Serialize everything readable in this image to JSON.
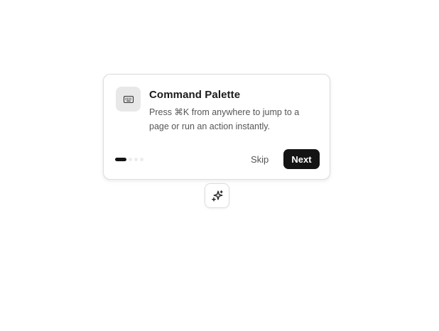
{
  "tour": {
    "icon": "keyboard-icon",
    "title": "Command Palette",
    "description": "Press ⌘K from anywhere to jump to a page or run an action instantly.",
    "progress": {
      "current_step": 1,
      "total_steps": 4
    },
    "skip_label": "Skip",
    "next_label": "Next"
  },
  "launcher": {
    "icon": "sparkles-icon"
  },
  "colors": {
    "primary": "#141414",
    "icon_tile": "#e8e8e8",
    "muted_text": "#555555",
    "inactive_dot": "#ececec"
  }
}
